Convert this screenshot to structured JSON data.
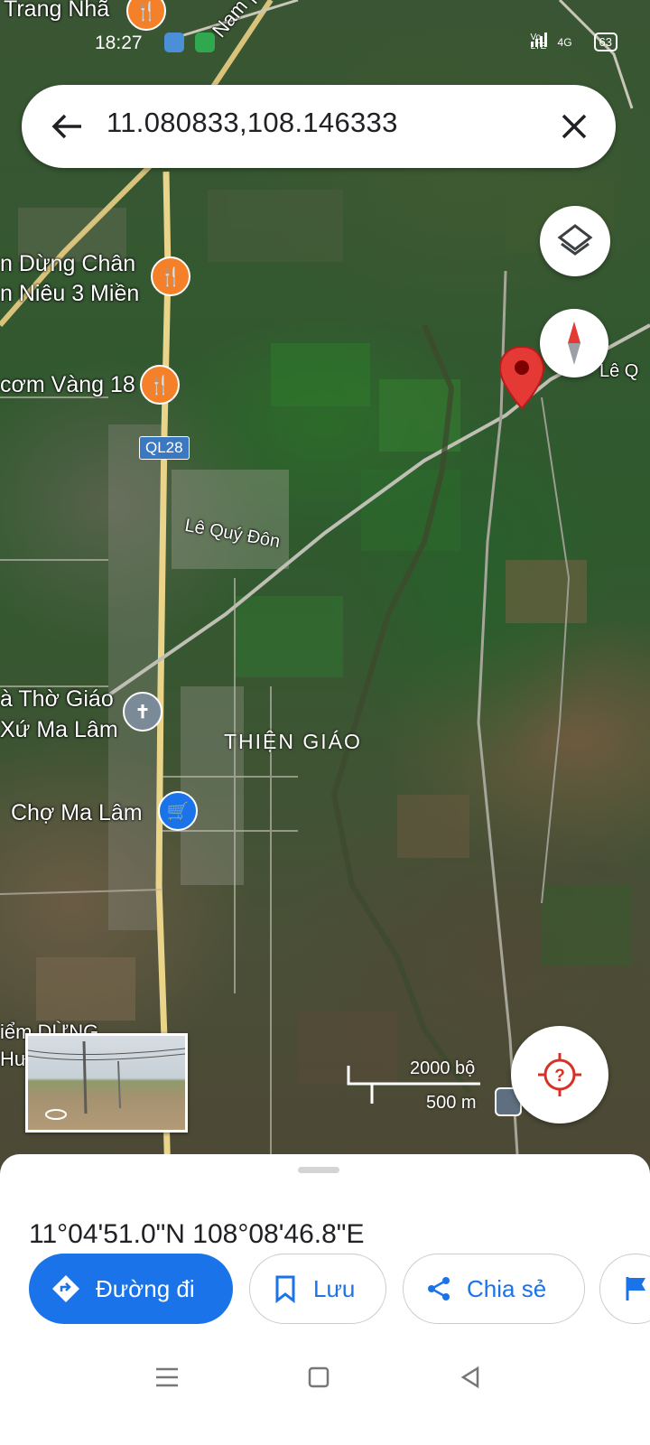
{
  "status_bar": {
    "time": "18:27",
    "network": "Vo LTE",
    "signal": "4G",
    "battery": "63"
  },
  "search": {
    "query": "11.080833,108.146333"
  },
  "map": {
    "labels": {
      "top_left": "Trang Nhã",
      "road_top": "Nam phía",
      "poi_1_line1": "n Dừng Chân",
      "poi_1_line2": "n Niêu 3 Miền",
      "poi_2": "cơm Vàng 18",
      "road_shield": "QL28",
      "street": "Lê Quý Đôn",
      "church_line1": "à Thờ Giáo",
      "church_line2": "Xứ Ma Lâm",
      "area": "THIỆN GIÁO",
      "market": "Chợ Ma Lâm",
      "bottom_left_line1": "iểm DỪNG",
      "bottom_left_line2": "Hư",
      "right_street": "Lê Q"
    },
    "scale": {
      "imperial": "2000 bộ",
      "metric": "500 m"
    },
    "pin_color": "#e53935"
  },
  "bottom_sheet": {
    "coordinates": "11°04'51.0\"N 108°08'46.8\"E",
    "actions": [
      {
        "label": "Đường đi",
        "icon": "directions-icon"
      },
      {
        "label": "Lưu",
        "icon": "bookmark-icon"
      },
      {
        "label": "Chia sẻ",
        "icon": "share-icon"
      },
      {
        "label": "",
        "icon": "flag-icon"
      }
    ]
  },
  "colors": {
    "accent": "#1a73e8",
    "pin": "#e53935",
    "poi_food": "#f4812a",
    "poi_shop": "#1a73e8",
    "poi_church": "#7a8a96"
  }
}
